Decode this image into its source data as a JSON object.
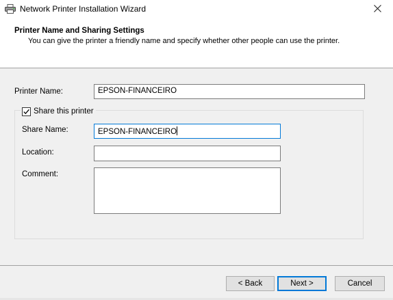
{
  "window": {
    "title": "Network Printer Installation Wizard"
  },
  "icons": {
    "app": "printer-icon",
    "close": "close-icon",
    "check": "checkmark-icon"
  },
  "header": {
    "title": "Printer Name and Sharing Settings",
    "subtitle": "You can give the printer a friendly name and specify whether other people can use the printer."
  },
  "form": {
    "printer_name_label": "Printer Name:",
    "printer_name_value": "EPSON-FINANCEIRO",
    "share_checkbox_label": "Share this printer",
    "share_checked": true,
    "share_name_label": "Share Name:",
    "share_name_value": "EPSON-FINANCEIRO",
    "location_label": "Location:",
    "location_value": "",
    "comment_label": "Comment:",
    "comment_value": ""
  },
  "buttons": {
    "back": "< Back",
    "next": "Next >",
    "cancel": "Cancel"
  },
  "colors": {
    "focus_border": "#0078d7",
    "dialog_bg": "#f0f0f0",
    "header_bg": "#ffffff"
  }
}
